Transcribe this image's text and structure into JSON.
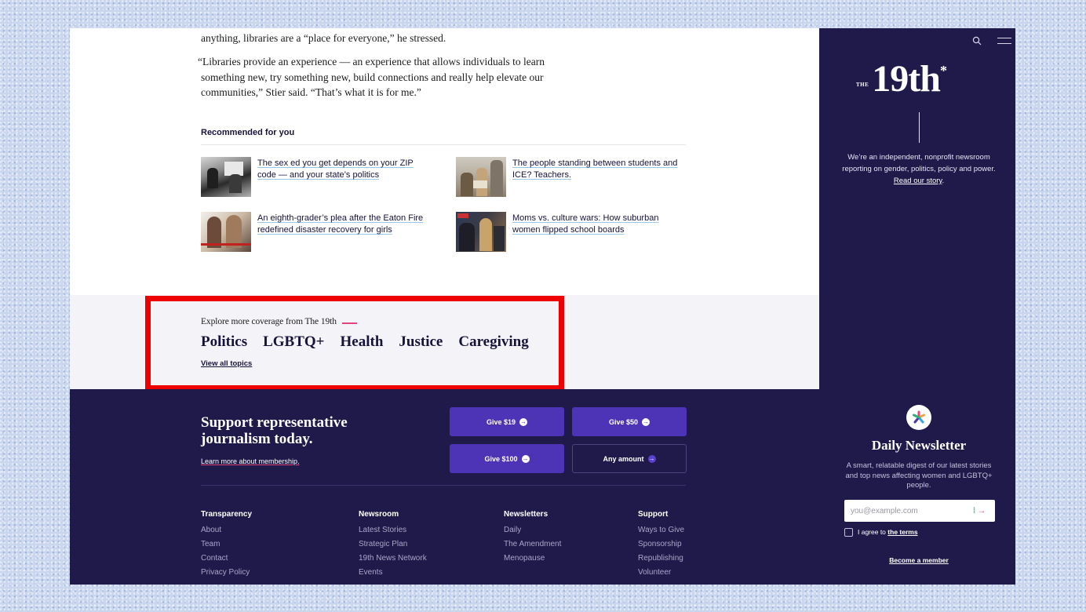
{
  "article": {
    "para1": "anything, libraries are a “place for everyone,” he stressed.",
    "para2": "“Libraries provide an experience — an experience that allows individuals to learn something new, try something new, build connections and really help elevate our communities,” Stier said. “That’s what it is for me.”"
  },
  "recommended": {
    "heading": "Recommended for you",
    "items": [
      {
        "title": "The sex ed you get depends on your ZIP code — and your state’s politics"
      },
      {
        "title": "The people standing between students and ICE? Teachers."
      },
      {
        "title": "An eighth-grader’s plea after the Eaton Fire redefined disaster recovery for girls"
      },
      {
        "title": "Moms vs. culture wars: How suburban women flipped school boards"
      }
    ]
  },
  "explore": {
    "label": "Explore more coverage from The 19th",
    "topics": [
      "Politics",
      "LGBTQ+",
      "Health",
      "Justice",
      "Caregiving"
    ],
    "view_all": "View all topics"
  },
  "support": {
    "title": "Support representative journalism today.",
    "learn_more": "Learn more about membership.",
    "buttons": [
      "Give $19",
      "Give $50",
      "Give $100",
      "Any amount"
    ]
  },
  "footer": {
    "columns": [
      {
        "heading": "Transparency",
        "items": [
          "About",
          "Team",
          "Contact",
          "Privacy Policy"
        ]
      },
      {
        "heading": "Newsroom",
        "items": [
          "Latest Stories",
          "Strategic Plan",
          "19th News Network",
          "Events"
        ]
      },
      {
        "heading": "Newsletters",
        "items": [
          "Daily",
          "The Amendment",
          "Menopause"
        ]
      },
      {
        "heading": "Support",
        "items": [
          "Ways to Give",
          "Sponsorship",
          "Republishing",
          "Volunteer"
        ]
      }
    ]
  },
  "sidebar": {
    "logo_the": "THE",
    "logo_main": "19th",
    "logo_star": "*",
    "tagline": "We’re an independent, nonprofit newsroom reporting on gender, politics, policy and power.",
    "tagline_link": "Read our story",
    "newsletter_title": "Daily Newsletter",
    "newsletter_desc": "A smart, relatable digest of our latest stories and top news affecting women and LGBTQ+ people.",
    "email_placeholder": "you@example.com",
    "agree_prefix": "I agree to",
    "agree_link": "the terms",
    "become_member": "Become a member"
  },
  "colors": {
    "navy": "#1f1a4a",
    "purple_button": "#4d33b5",
    "accent_pink": "#e0457b",
    "highlight_red": "#ee0000"
  }
}
